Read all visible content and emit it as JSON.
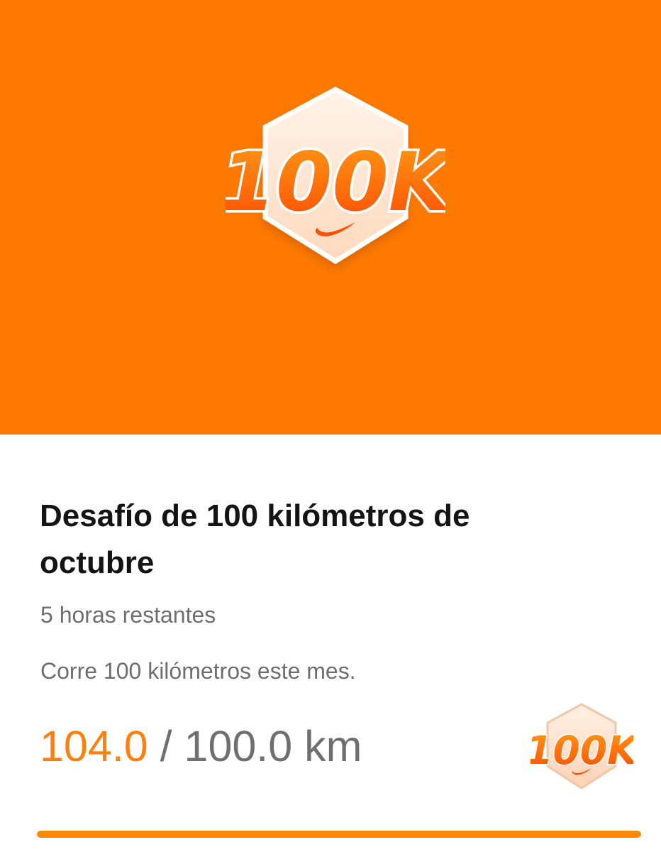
{
  "badge": {
    "text": "100K",
    "icon": "nike-swoosh-icon"
  },
  "challenge": {
    "title": "Desafío de 100 kilómetros de octubre",
    "time_remaining": "5 horas restantes",
    "description": "Corre 100 kilómetros este mes."
  },
  "progress": {
    "current": "104.0",
    "separator": "/",
    "goal": "100.0",
    "unit": "km",
    "percent_complete": 100
  },
  "colors": {
    "hero_background": "#ff7a00",
    "accent_orange": "#ff7f0f",
    "badge_text": "#ff5a00",
    "secondary_text": "#6e6e6e"
  }
}
